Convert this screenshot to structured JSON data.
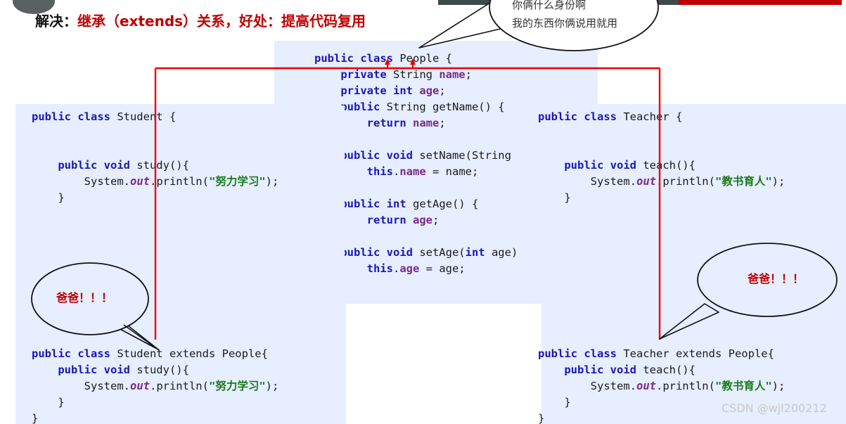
{
  "slide": {
    "title_prefix": "解决：",
    "title_main": "继承（extends）关系，好处：提高代码复用",
    "watermark": "CSDN @wjl200212",
    "accent_red": "#c00000",
    "panel_blue": "#e6eeff",
    "keyword_color": "#1a17b8",
    "string_color": "#1a7a1a",
    "field_color": "#7a2a8c"
  },
  "bubbles": {
    "top": {
      "line1": "你俩什么身份啊",
      "line2": "我的东西你俩说用就用"
    },
    "left": {
      "text": "爸爸！！！"
    },
    "right": {
      "text": "爸爸！！！"
    }
  },
  "code": {
    "people": {
      "title": "People",
      "lines": [
        "public class People {",
        "    private String name;",
        "    private int age;",
        "    public String getName() {",
        "        return name;",
        "",
        "    public void setName(String",
        "        this.name = name;",
        "",
        "    public int getAge() {",
        "        return age;",
        "",
        "    public void setAge(int age)",
        "        this.age = age;"
      ]
    },
    "student_top": {
      "title": "Student",
      "lines": [
        "public class Student {",
        "",
        "",
        "    public void study(){",
        "        System.out.println(\"努力学习\");",
        "    }"
      ]
    },
    "teacher_top": {
      "title": "Teacher",
      "lines": [
        "public class Teacher {",
        "",
        "",
        "    public void teach(){",
        "        System.out.println(\"教书育人\");",
        "    }"
      ]
    },
    "student_bottom": {
      "title": "Student extends People",
      "lines": [
        "public class Student extends People{",
        "    public void study(){",
        "        System.out.println(\"努力学习\");",
        "    }",
        "}"
      ]
    },
    "teacher_bottom": {
      "title": "Teacher extends People",
      "lines": [
        "public class Teacher extends People{",
        "    public void teach(){",
        "        System.out.println(\"教书育人\");",
        "    }",
        "}"
      ]
    }
  }
}
